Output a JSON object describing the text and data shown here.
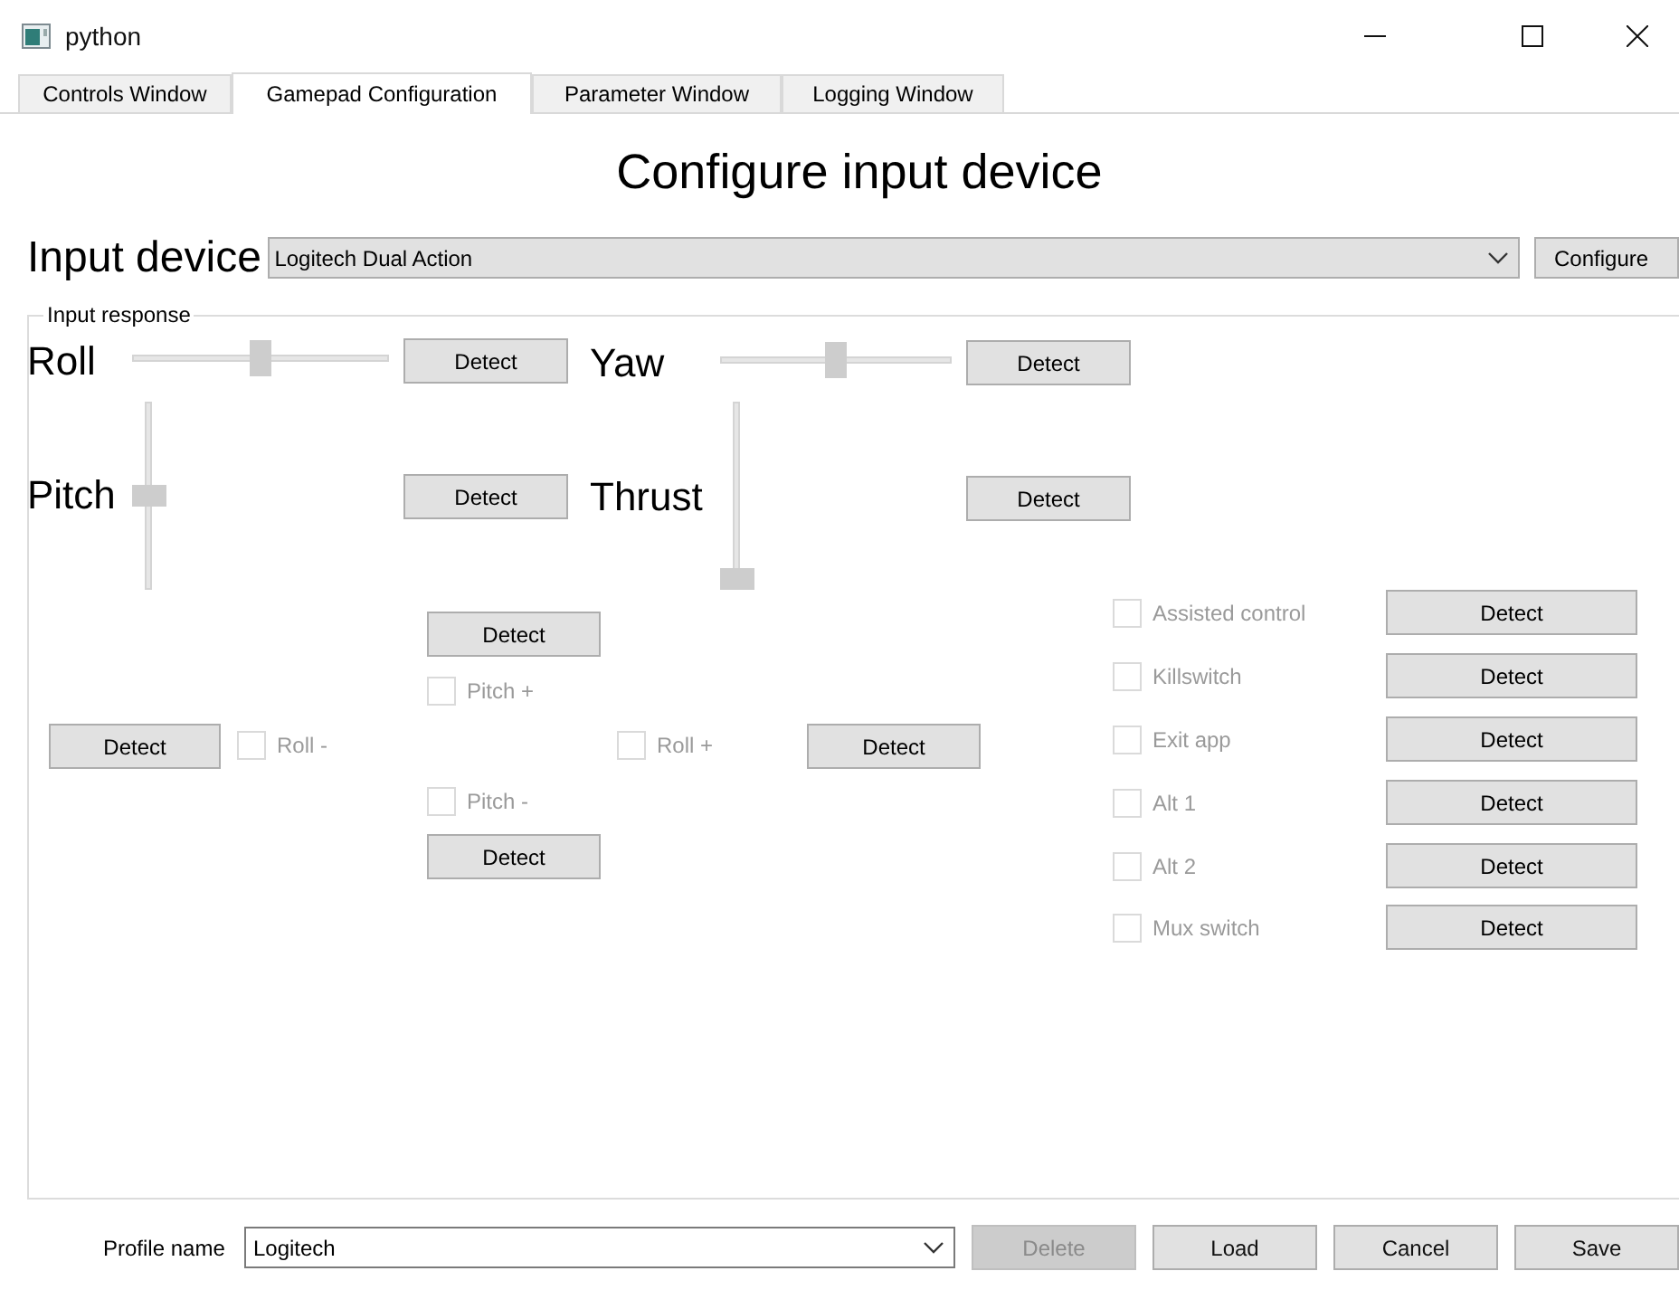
{
  "window": {
    "title": "python"
  },
  "tabs": [
    {
      "label": "Controls Window",
      "selected": false
    },
    {
      "label": "Gamepad Configuration",
      "selected": true
    },
    {
      "label": "Parameter Window",
      "selected": false
    },
    {
      "label": "Logging Window",
      "selected": false
    }
  ],
  "heading": "Configure input device",
  "input_device": {
    "label": "Input device",
    "value": "Logitech Dual Action",
    "button": "Configure"
  },
  "input_response": {
    "title": "Input response",
    "axes": [
      {
        "label": "Roll",
        "kind": "horizontal",
        "level": 0.5,
        "button": "Detect"
      },
      {
        "label": "Yaw",
        "kind": "horizontal",
        "level": 0.5,
        "button": "Detect"
      },
      {
        "label": "Pitch",
        "kind": "vertical",
        "level": 0.5,
        "button": "Detect"
      },
      {
        "label": "Thrust",
        "kind": "vertical",
        "level": 0.0,
        "button": "Detect"
      }
    ],
    "directions": [
      {
        "label": "Pitch +",
        "checked": false,
        "disabled": true,
        "button": "Detect"
      },
      {
        "label": "Roll -",
        "checked": false,
        "disabled": true,
        "button": "Detect"
      },
      {
        "label": "Roll +",
        "checked": false,
        "disabled": true,
        "button": "Detect"
      },
      {
        "label": "Pitch -",
        "checked": false,
        "disabled": true,
        "button": "Detect"
      }
    ],
    "switches": [
      {
        "label": "Assisted control",
        "checked": false,
        "disabled": true,
        "button": "Detect"
      },
      {
        "label": "Killswitch",
        "checked": false,
        "disabled": true,
        "button": "Detect"
      },
      {
        "label": "Exit app",
        "checked": false,
        "disabled": true,
        "button": "Detect"
      },
      {
        "label": "Alt 1",
        "checked": false,
        "disabled": true,
        "button": "Detect"
      },
      {
        "label": "Alt 2",
        "checked": false,
        "disabled": true,
        "button": "Detect"
      },
      {
        "label": "Mux switch",
        "checked": false,
        "disabled": true,
        "button": "Detect"
      }
    ]
  },
  "profile": {
    "label": "Profile name",
    "value": "Logitech",
    "buttons": [
      {
        "label": "Delete",
        "disabled": true
      },
      {
        "label": "Load",
        "disabled": false
      },
      {
        "label": "Cancel",
        "disabled": false
      },
      {
        "label": "Save",
        "disabled": false
      }
    ]
  }
}
